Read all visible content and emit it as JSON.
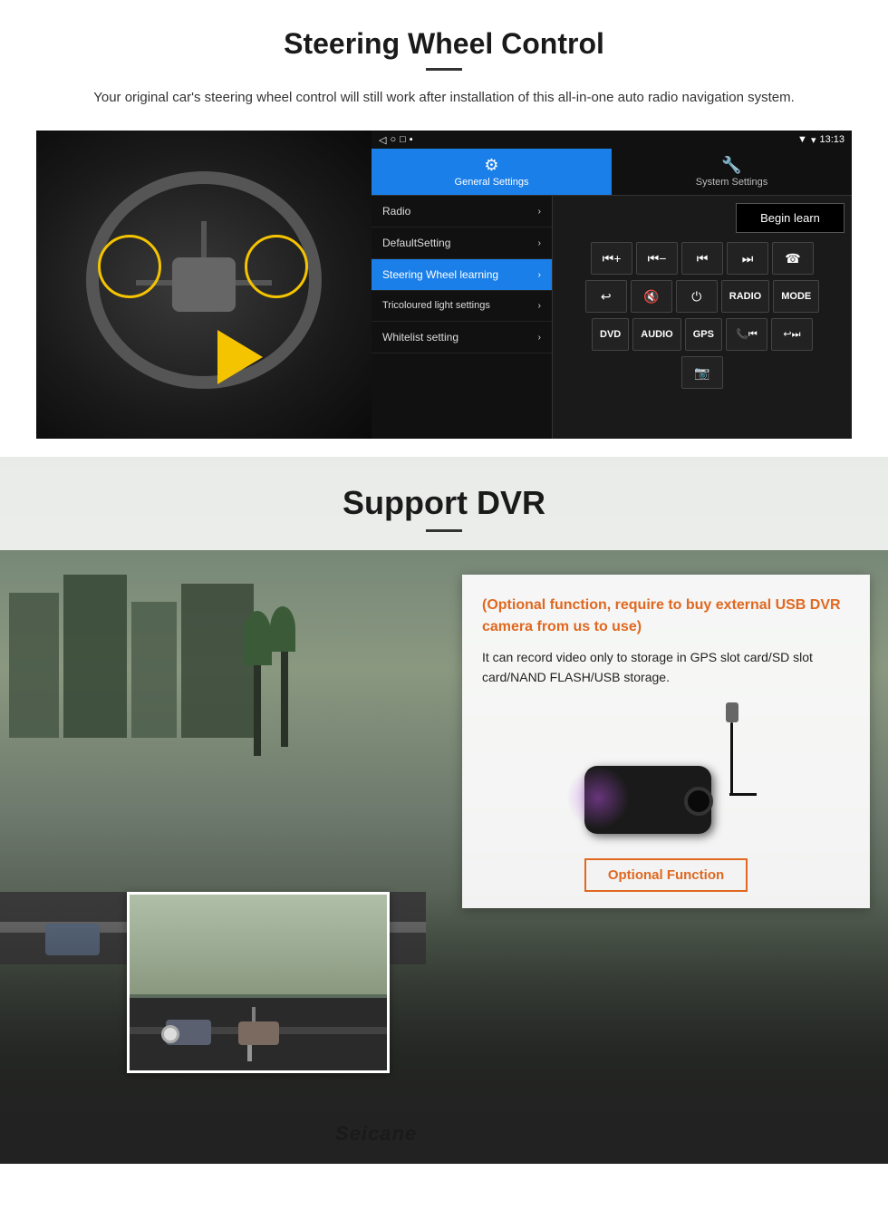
{
  "page": {
    "sections": {
      "steering": {
        "title": "Steering Wheel Control",
        "subtitle": "Your original car's steering wheel control will still work after installation of this all-in-one auto radio navigation system.",
        "android_ui": {
          "statusbar": {
            "signal": "▼",
            "wifi": "▾",
            "time": "13:13"
          },
          "tabs": [
            {
              "label": "General Settings",
              "active": true,
              "icon": "⚙"
            },
            {
              "label": "System Settings",
              "active": false,
              "icon": "🔧"
            }
          ],
          "menu_items": [
            {
              "label": "Radio",
              "active": false,
              "has_arrow": true
            },
            {
              "label": "DefaultSetting",
              "active": false,
              "has_arrow": true
            },
            {
              "label": "Steering Wheel learning",
              "active": true,
              "has_arrow": true
            },
            {
              "label": "Tricoloured light settings",
              "active": false,
              "has_arrow": true
            },
            {
              "label": "Whitelist setting",
              "active": false,
              "has_arrow": true
            }
          ],
          "begin_learn_button": "Begin learn",
          "control_buttons_row1": [
            "⏮+",
            "⏮−",
            "⏮⏮",
            "⏭⏭",
            "☎"
          ],
          "control_buttons_row2": [
            "☎↩",
            "🔇",
            "⏻",
            "RADIO",
            "MODE"
          ],
          "control_buttons_row3": [
            "DVD",
            "AUDIO",
            "GPS",
            "📞⏮",
            "↩⏭"
          ]
        }
      },
      "dvr": {
        "title": "Support DVR",
        "card": {
          "title_text": "(Optional function, require to buy external USB DVR camera from us to use)",
          "body_text": "It can record video only to storage in GPS slot card/SD slot card/NAND FLASH/USB storage.",
          "optional_button_label": "Optional Function"
        },
        "branding": "Seicane"
      }
    }
  }
}
